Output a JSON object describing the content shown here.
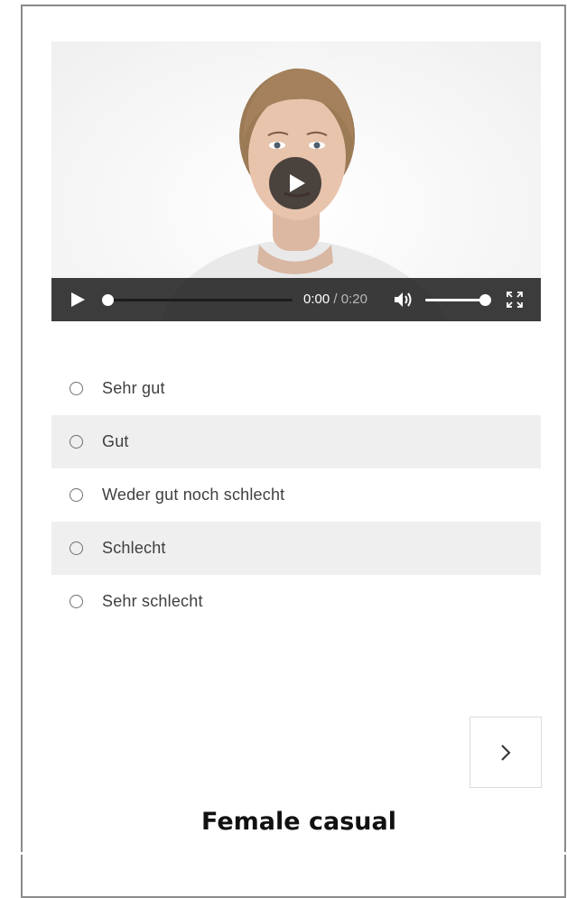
{
  "video": {
    "current_time": "0:00",
    "duration": "0:20",
    "progress_fraction": 0.0,
    "volume_fraction": 1.0,
    "icons": {
      "big_play": "play-icon",
      "play": "play-icon",
      "volume": "volume-icon",
      "fullscreen": "fullscreen-icon"
    }
  },
  "options": [
    {
      "label": "Sehr gut"
    },
    {
      "label": "Gut"
    },
    {
      "label": "Weder gut noch schlecht"
    },
    {
      "label": "Schlecht"
    },
    {
      "label": "Sehr schlecht"
    }
  ],
  "navigation": {
    "next_icon": "chevron-right-icon"
  },
  "caption": "Female casual",
  "colors": {
    "control_bar": "#141414",
    "row_shade": "#efefef",
    "text": "#3f3f3f"
  }
}
